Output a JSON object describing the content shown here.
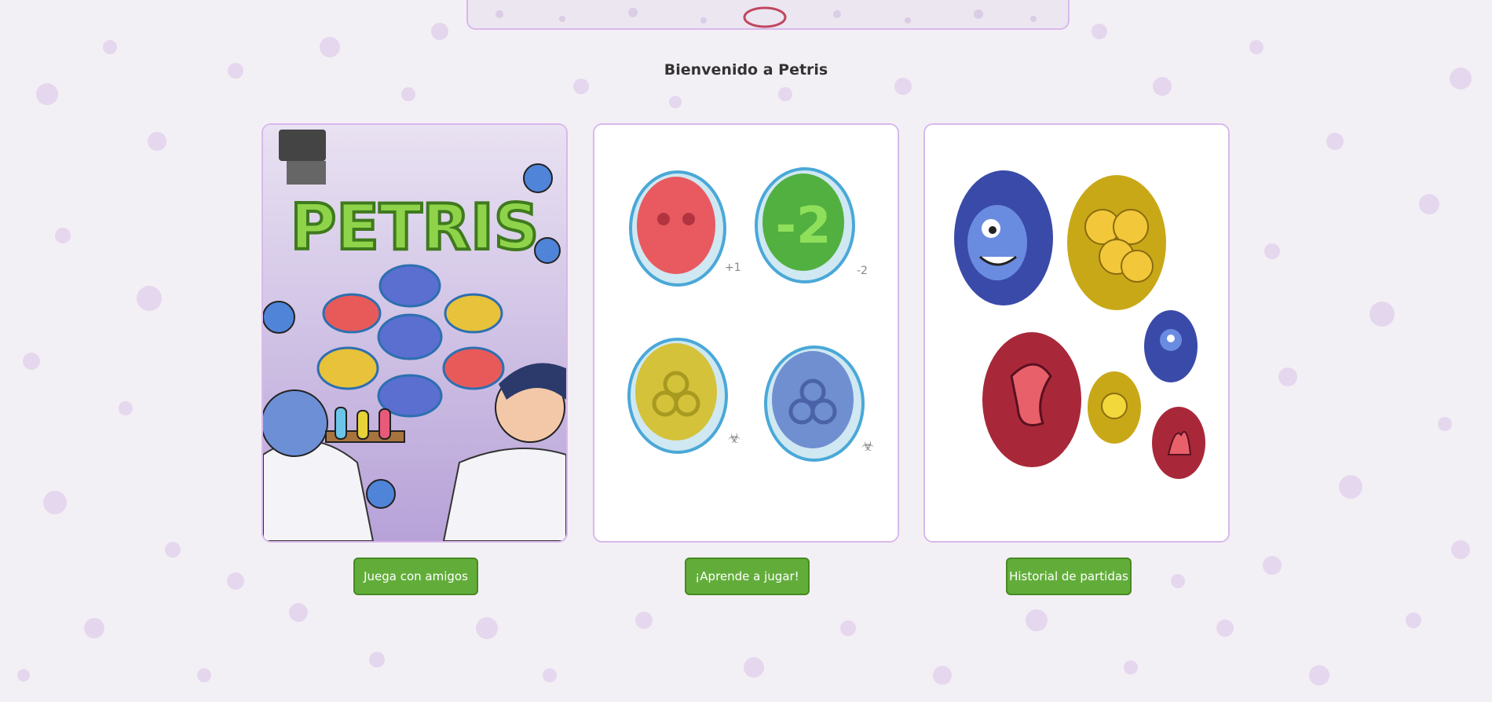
{
  "page": {
    "title": "Bienvenido a Petris"
  },
  "cards": [
    {
      "logo_text": "PETRIS",
      "button_label": "Juega con amigos"
    },
    {
      "button_label": "¡Aprende a jugar!"
    },
    {
      "button_label": "Historial de partidas"
    }
  ],
  "dish_badges": [
    "+1",
    "-2"
  ],
  "colors": {
    "button_green": "#62ad3a",
    "card_border": "#d9b8ec",
    "background": "#f3f0f5"
  }
}
